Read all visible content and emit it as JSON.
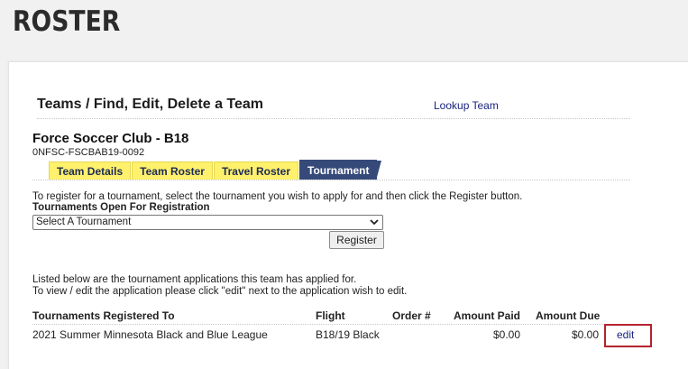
{
  "page": {
    "title": "ROSTER"
  },
  "section": {
    "heading": "Teams / Find, Edit, Delete a Team",
    "lookup_link": "Lookup Team"
  },
  "team": {
    "name": "Force Soccer Club - B18",
    "code": "0NFSC-FSCBAB19-0092"
  },
  "tabs": [
    {
      "label": "Team Details",
      "active": false
    },
    {
      "label": "Team Roster",
      "active": false
    },
    {
      "label": "Travel Roster",
      "active": false
    },
    {
      "label": "Tournament",
      "active": true
    }
  ],
  "register": {
    "instructions": "To register for a tournament, select the tournament you wish to apply for and then click the Register button.",
    "open_label": "Tournaments Open For Registration",
    "select_value": "Select A Tournament",
    "button_label": "Register"
  },
  "applications": {
    "intro_line1": "Listed below are the tournament applications this team has applied for.",
    "intro_line2": "To view / edit the application please click \"edit\" next to the application wish to edit.",
    "columns": [
      "Tournaments Registered To",
      "Flight",
      "Order #",
      "Amount Paid",
      "Amount Due"
    ],
    "rows": [
      {
        "tournament": "2021 Summer Minnesota Black and Blue League",
        "flight": "B18/19 Black",
        "order": "",
        "amount_paid": "$0.00",
        "amount_due": "$0.00",
        "action": "edit"
      }
    ]
  },
  "colors": {
    "tab_inactive": "#fff16b",
    "tab_active": "#364a7a",
    "link": "#1a237e",
    "highlight_box": "#b5232d"
  }
}
